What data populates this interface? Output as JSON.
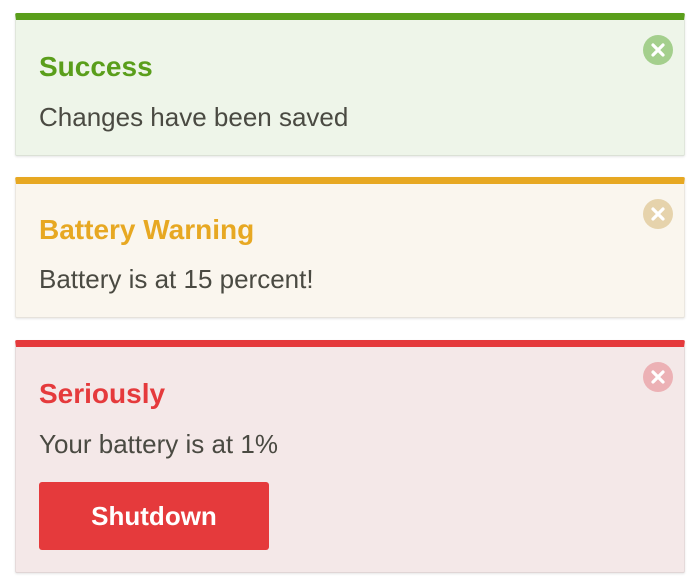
{
  "alerts": [
    {
      "type": "success",
      "title": "Success",
      "message": "Changes have been saved",
      "accent_color": "#5a9e1b",
      "background": "#eef5e9",
      "close_icon": "close-icon"
    },
    {
      "type": "warning",
      "title": "Battery Warning",
      "message": "Battery is at 15 percent!",
      "accent_color": "#e7a822",
      "background": "#faf6ee",
      "close_icon": "close-icon"
    },
    {
      "type": "danger",
      "title": "Seriously",
      "message": "Your battery is at 1%",
      "accent_color": "#e53a3c",
      "background": "#f4e8e8",
      "close_icon": "close-icon",
      "button_label": "Shutdown"
    }
  ]
}
